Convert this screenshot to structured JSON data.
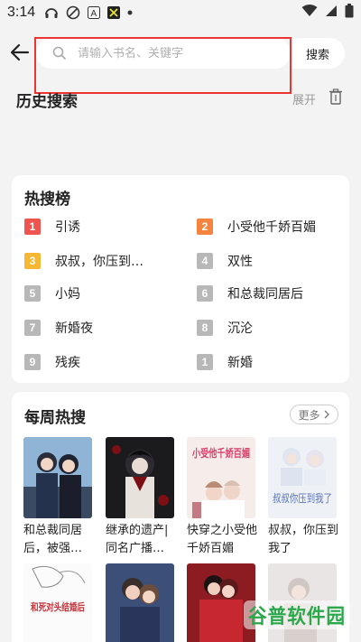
{
  "status": {
    "time": "3:14"
  },
  "search": {
    "placeholder": "请输入书名、关键字",
    "button": "搜索"
  },
  "history": {
    "title": "历史搜索",
    "expand": "展开"
  },
  "hot": {
    "title": "热搜榜",
    "items": [
      {
        "rank": "1",
        "label": "引诱",
        "color": "#f0544f"
      },
      {
        "rank": "2",
        "label": "小受他千娇百媚",
        "color": "#f5843f"
      },
      {
        "rank": "3",
        "label": "叔叔，你压到…",
        "color": "#f7b733"
      },
      {
        "rank": "4",
        "label": "双性",
        "color": "#b8b8b8"
      },
      {
        "rank": "5",
        "label": "小妈",
        "color": "#b8b8b8"
      },
      {
        "rank": "6",
        "label": "和总裁同居后",
        "color": "#b8b8b8"
      },
      {
        "rank": "7",
        "label": "新婚夜",
        "color": "#b8b8b8"
      },
      {
        "rank": "8",
        "label": "沉沦",
        "color": "#b8b8b8"
      },
      {
        "rank": "9",
        "label": "残疾",
        "color": "#b8b8b8"
      },
      {
        "rank": "1",
        "label": "新婚",
        "color": "#b8b8b8"
      }
    ]
  },
  "weekly": {
    "title": "每周热搜",
    "more": "更多",
    "books": [
      {
        "title": "和总裁同居后，被强…"
      },
      {
        "title": "继承的遗产|同名广播…"
      },
      {
        "title": "快穿之小受他千娇百媚"
      },
      {
        "title": "叔叔，你压到我了"
      }
    ],
    "cover_texts": {
      "cover3": "小受他千娇百媚",
      "cover4": "叔叔你压到我了",
      "cover5": "和死对头结婚后"
    }
  },
  "watermark": "谷普软件园"
}
